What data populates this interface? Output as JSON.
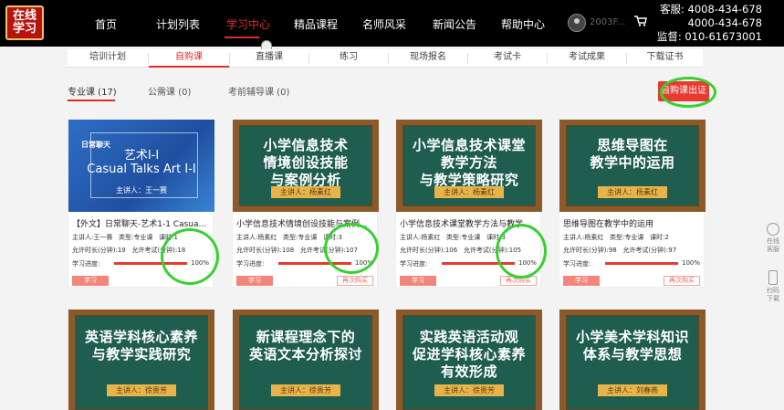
{
  "header": {
    "logo_text": "在线学习",
    "nav": [
      "首页",
      "计划列表",
      "学习中心",
      "精品课程",
      "名师风采",
      "新闻公告",
      "帮助中心"
    ],
    "active_nav": "学习中心",
    "username": "2003F...",
    "contact": [
      "客服: 4008-434-678",
      "4000-434-678",
      "监督: 010-61673001"
    ]
  },
  "subnav": {
    "items": [
      "培训计划",
      "自购课",
      "直播课",
      "练习",
      "现场报名",
      "考试卡",
      "考试成果",
      "下载证书"
    ],
    "active": "自购课"
  },
  "categories": [
    "专业课 (17)",
    "公需课 (0)",
    "考前辅导课 (0)"
  ],
  "cert_button": "自购课出证",
  "labels": {
    "speaker": "主讲人:",
    "type": "类型:",
    "hours": "课时:",
    "allow_time": "允许时长(分钟):",
    "allow_exam": "允许考试(分钟):",
    "progress": "学习进度:",
    "study": "学习",
    "rebuy": "再次购买"
  },
  "courses": [
    {
      "style": "blue",
      "thumb_tag": "日常聊天",
      "thumb_title": "艺术I-I",
      "thumb_subtitle": "Casual Talks Art I-I",
      "thumb_speaker": "主讲人：王一赛",
      "name": "【外文】日常聊天-艺术1-1 Casua...",
      "speaker": "王一赛",
      "type": "专业课",
      "hours": "1",
      "allow_time": "19",
      "allow_exam": "18",
      "progress": "100%",
      "progress_value": 100
    },
    {
      "style": "board",
      "thumb_title": "小学信息技术\n情境创设技能\n与案例分析",
      "thumb_speaker": "主讲人：杨素红",
      "name": "小学信息技术情境创设技能与案例...",
      "speaker": "杨素红",
      "type": "专业课",
      "hours": "3",
      "allow_time": "108",
      "allow_exam": "107",
      "progress": "100%",
      "progress_value": 100
    },
    {
      "style": "board",
      "thumb_title": "小学信息技术课堂\n教学方法\n与教学策略研究",
      "thumb_speaker": "主讲人：杨素红",
      "name": "小学信息技术课堂教学方法与教学...",
      "speaker": "杨素红",
      "type": "专业课",
      "hours": "3",
      "allow_time": "106",
      "allow_exam": "105",
      "progress": "100%",
      "progress_value": 100
    },
    {
      "style": "board",
      "thumb_title": "思维导图在\n教学中的运用",
      "thumb_speaker": "主讲人：杨素红",
      "name": "思维导图在教学中的运用",
      "speaker": "杨素红",
      "type": "专业课",
      "hours": "2",
      "allow_time": "98",
      "allow_exam": "97",
      "progress": "100%",
      "progress_value": 100
    }
  ],
  "courses_row2": [
    {
      "thumb_title": "英语学科核心素养\n与教学实践研究",
      "thumb_speaker": "主讲人：徐贵芳"
    },
    {
      "thumb_title": "新课程理念下的\n英语文本分析探讨",
      "thumb_speaker": "主讲人：徐贵芳"
    },
    {
      "thumb_title": "实践英语活动观\n促进学科核心素养\n有效形成",
      "thumb_speaker": "主讲人：徐贵芳"
    },
    {
      "thumb_title": "小学美术学科知识\n体系与教学思想",
      "thumb_speaker": "主讲人：刘春燕"
    }
  ],
  "side": {
    "service": "在线\n客服",
    "app": "扫码\n下载"
  },
  "colors": {
    "accent": "#e02e24",
    "highlight": "#36d12f",
    "board": "#1f5d4f"
  }
}
